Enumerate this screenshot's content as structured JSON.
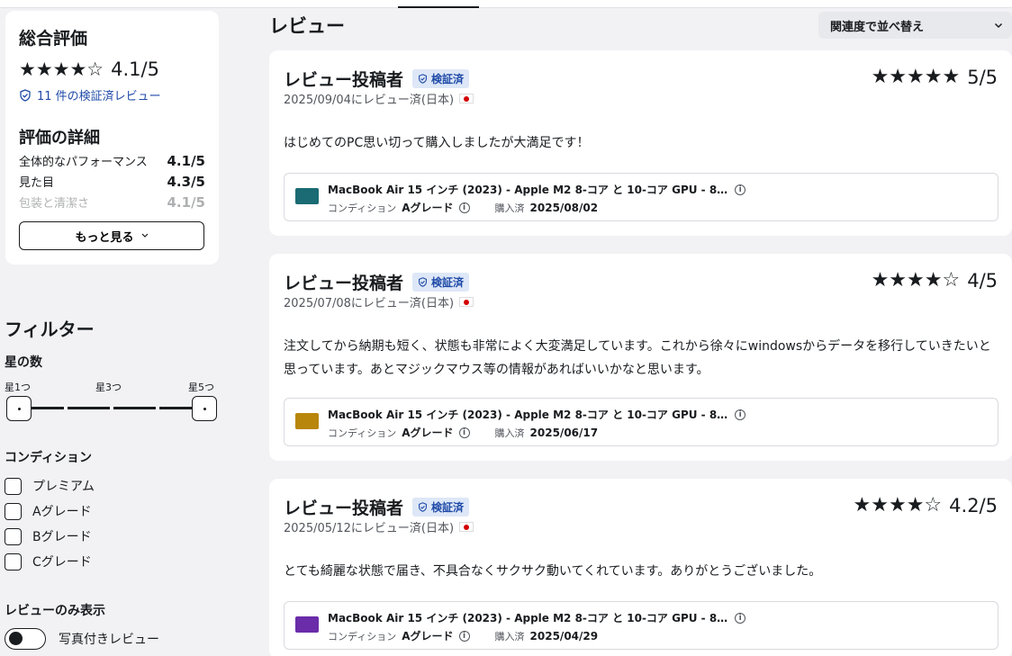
{
  "summary": {
    "title": "総合評価",
    "stars": "★★★★☆",
    "score": "4.1/5",
    "verified_count": "11 件の検証済レビュー",
    "details_title": "評価の詳細",
    "details": [
      {
        "label": "全体的なパフォーマンス",
        "value": "4.1/5"
      },
      {
        "label": "見た目",
        "value": "4.3/5"
      },
      {
        "label": "包装と清潔さ",
        "value": "4.1/5"
      }
    ],
    "more_button": "もっと見る"
  },
  "filters": {
    "title": "フィルター",
    "stars_title": "星の数",
    "range_labels": [
      "星1つ",
      "星3つ",
      "星5つ"
    ],
    "condition_title": "コンディション",
    "conditions": [
      "プレミアム",
      "Aグレード",
      "Bグレード",
      "Cグレード"
    ],
    "reviews_only_title": "レビューのみ表示",
    "photo_toggle": "写真付きレビュー"
  },
  "header": {
    "title": "レビュー",
    "sort_label": "関連度で並べ替え"
  },
  "reviews": [
    {
      "author": "レビュー投稿者",
      "badge": "検証済",
      "date": "2025/09/04にレビュー済(日本)",
      "stars": "★★★★★",
      "score": "5/5",
      "text": "はじめてのPC思い切って購入しましたが大満足です！",
      "product_name": "MacBook Air 15 インチ (2023) - Apple M2 8-コア と 10-コア GPU - 8…",
      "condition_label": "コンディション",
      "condition_value": "Aグレード",
      "purchased_label": "購入済",
      "purchased_date": "2025/08/02",
      "thumb_color": "#1a6b73"
    },
    {
      "author": "レビュー投稿者",
      "badge": "検証済",
      "date": "2025/07/08にレビュー済(日本)",
      "stars": "★★★★☆",
      "score": "4/5",
      "text": "注文してから納期も短く、状態も非常によく大変満足しています。これから徐々にwindowsからデータを移行していきたいと思っています。あとマジックマウス等の情報があればいいかなと思います。",
      "product_name": "MacBook Air 15 インチ (2023) - Apple M2 8-コア と 10-コア GPU - 8…",
      "condition_label": "コンディション",
      "condition_value": "Aグレード",
      "purchased_label": "購入済",
      "purchased_date": "2025/06/17",
      "thumb_color": "#b8860b"
    },
    {
      "author": "レビュー投稿者",
      "badge": "検証済",
      "date": "2025/05/12にレビュー済(日本)",
      "stars": "★★★★☆",
      "score": "4.2/5",
      "text": "とても綺麗な状態で届き、不具合なくサクサク動いてくれています。ありがとうございました。",
      "product_name": "MacBook Air 15 インチ (2023) - Apple M2 8-コア と 10-コア GPU - 8…",
      "condition_label": "コンディション",
      "condition_value": "Aグレード",
      "purchased_label": "購入済",
      "purchased_date": "2025/04/29",
      "thumb_color": "#6a2ca8"
    }
  ],
  "icons": {
    "shield": "shield-check-icon",
    "chevron": "chevron-down-icon",
    "info": "info-icon"
  }
}
